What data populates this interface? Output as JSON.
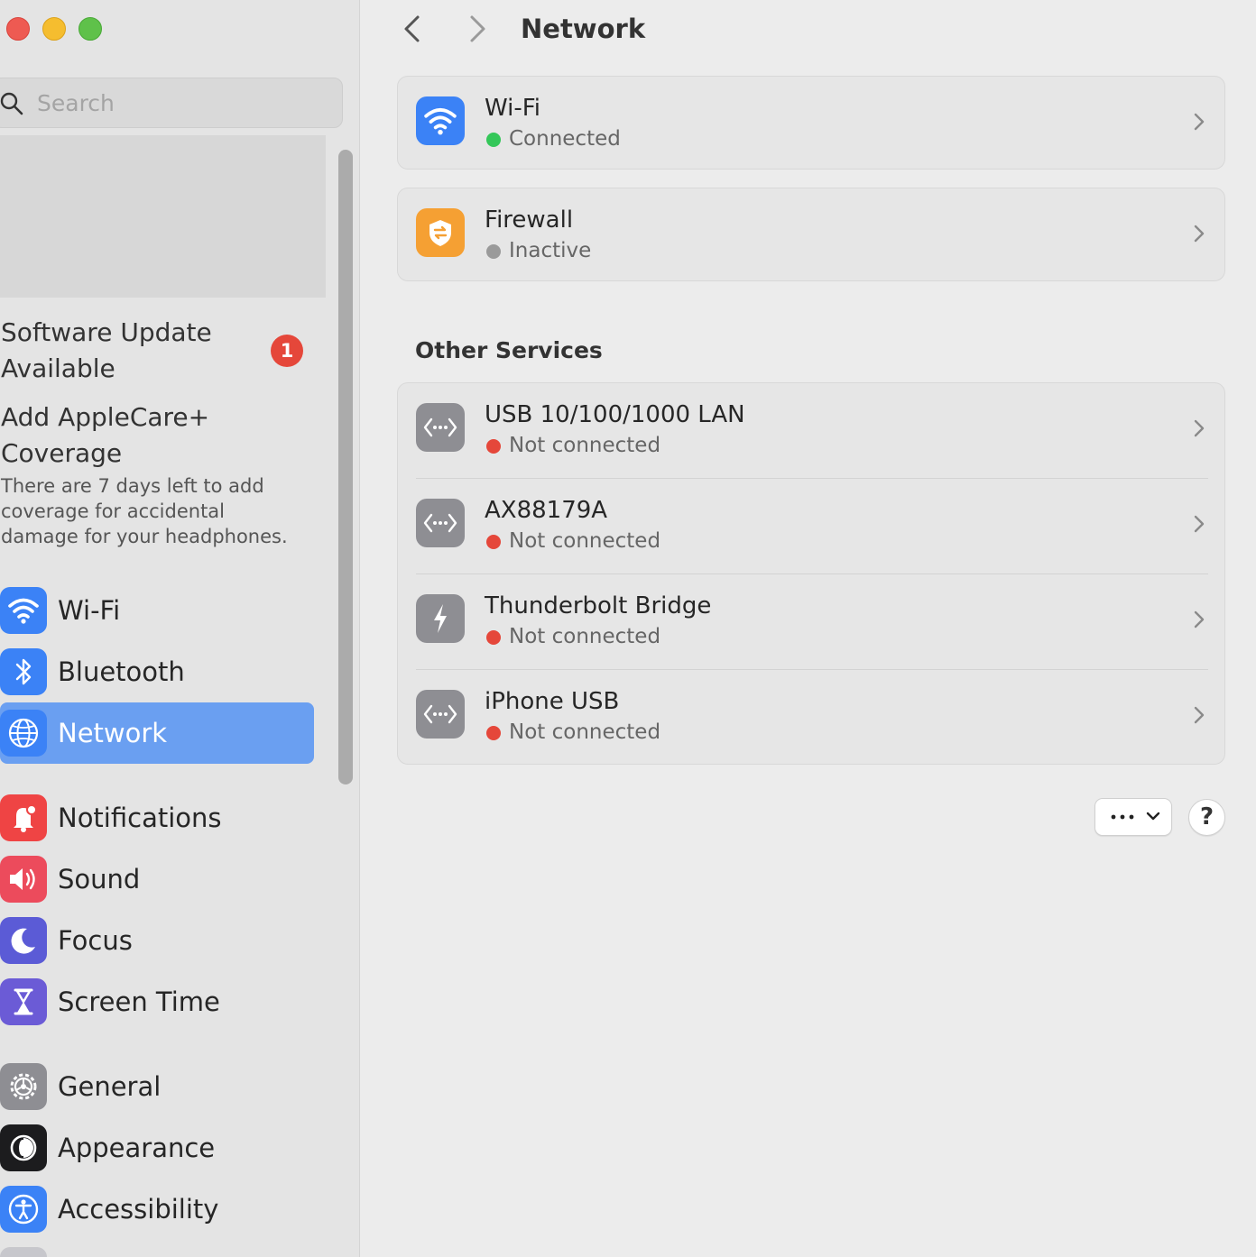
{
  "window": {
    "controls": {
      "close": "close",
      "minimize": "minimize",
      "zoom": "zoom"
    }
  },
  "sidebar": {
    "search": {
      "placeholder": "Search",
      "value": ""
    },
    "update": {
      "title": "Software Update Available",
      "badge": "1"
    },
    "applecare": {
      "title": "Add AppleCare+ Coverage",
      "description": "There are 7 days left to add coverage for accidental damage for your headphones."
    },
    "items": [
      {
        "label": "Wi-Fi",
        "icon": "wifi-icon",
        "color": "#3b82f6"
      },
      {
        "label": "Bluetooth",
        "icon": "bluetooth-icon",
        "color": "#3b82f6"
      },
      {
        "label": "Network",
        "icon": "globe-icon",
        "color": "#3b82f6",
        "selected": true
      },
      {
        "label": "Notifications",
        "icon": "bell-icon",
        "color": "#ef4444"
      },
      {
        "label": "Sound",
        "icon": "speaker-icon",
        "color": "#ec4b5c"
      },
      {
        "label": "Focus",
        "icon": "moon-icon",
        "color": "#5b5bd6"
      },
      {
        "label": "Screen Time",
        "icon": "hourglass-icon",
        "color": "#6b5bd6"
      },
      {
        "label": "General",
        "icon": "gear-icon",
        "color": "#8e8e93"
      },
      {
        "label": "Appearance",
        "icon": "appearance-icon",
        "color": "#1c1c1e"
      },
      {
        "label": "Accessibility",
        "icon": "accessibility-icon",
        "color": "#3b82f6"
      }
    ]
  },
  "main": {
    "title": "Network",
    "primary": [
      {
        "title": "Wi-Fi",
        "status": "Connected",
        "status_color": "#34c759",
        "icon": "wifi-icon",
        "icon_color": "#3b82f6"
      },
      {
        "title": "Firewall",
        "status": "Inactive",
        "status_color": "#9a9a9a",
        "icon": "firewall-icon",
        "icon_color": "#f5a033"
      }
    ],
    "other_services_title": "Other Services",
    "services": [
      {
        "title": "USB 10/100/1000 LAN",
        "status": "Not connected",
        "status_color": "#e5473a",
        "icon": "ethernet-icon"
      },
      {
        "title": "AX88179A",
        "status": "Not connected",
        "status_color": "#e5473a",
        "icon": "ethernet-icon"
      },
      {
        "title": "Thunderbolt Bridge",
        "status": "Not connected",
        "status_color": "#e5473a",
        "icon": "thunderbolt-icon"
      },
      {
        "title": "iPhone USB",
        "status": "Not connected",
        "status_color": "#e5473a",
        "icon": "ethernet-icon"
      }
    ],
    "help_label": "?"
  }
}
